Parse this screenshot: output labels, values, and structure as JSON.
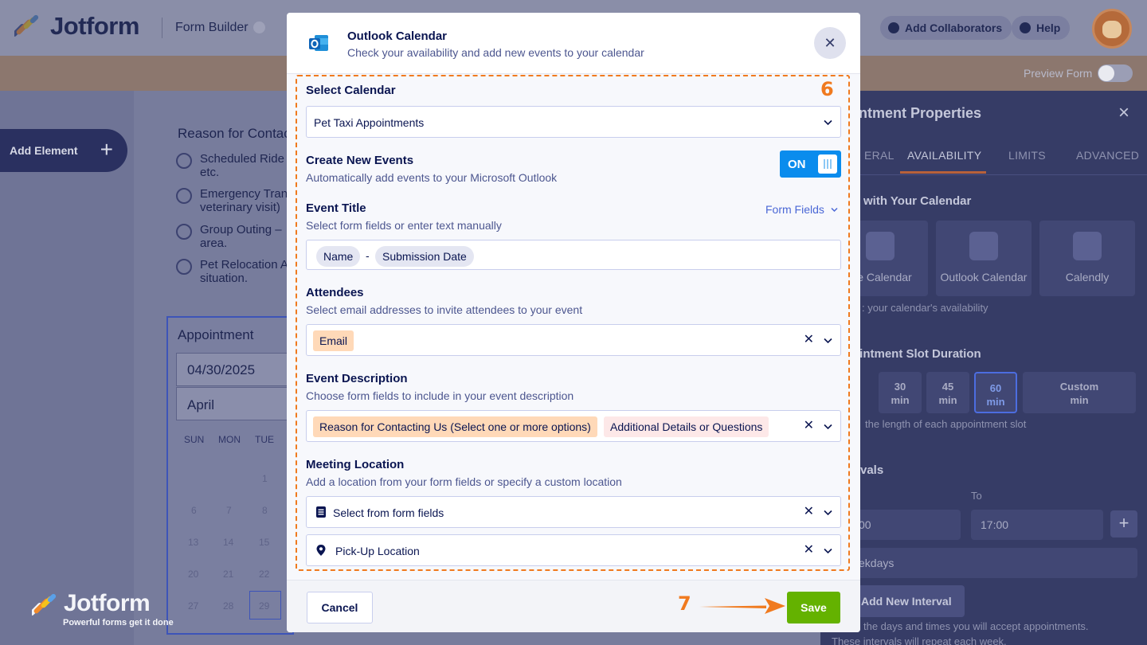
{
  "app": {
    "logo_text": "Jotform",
    "builder_label": "Form Builder",
    "add_collaborators": "Add Collaborators",
    "help": "Help",
    "preview_form": "Preview Form",
    "add_element": "Add Element"
  },
  "form_canvas": {
    "reason_title": "Reason for Contac",
    "options": [
      {
        "line1": "Scheduled Ride",
        "line2": "etc."
      },
      {
        "line1": "Emergency Tran",
        "line2": "veterinary visit)"
      },
      {
        "line1": "Group Outing –",
        "line2": "area."
      },
      {
        "line1": "Pet Relocation A",
        "line2": "situation."
      }
    ],
    "appointment_title": "Appointment",
    "date_value": "04/30/2025",
    "month_value": "April",
    "weekdays": [
      "SUN",
      "MON",
      "TUE"
    ],
    "days": [
      "1",
      "6",
      "7",
      "8",
      "13",
      "14",
      "15",
      "20",
      "21",
      "22",
      "27",
      "28",
      "29"
    ]
  },
  "watermark": {
    "name": "Jotform",
    "tagline": "Powerful forms get it done"
  },
  "properties_panel": {
    "title": "ointment Properties",
    "tabs": [
      "ERAL",
      "AVAILABILITY",
      "LIMITS",
      "ADVANCED"
    ],
    "active_tab": "AVAILABILITY",
    "sync_heading": "with Your Calendar",
    "calendars": [
      "gle Calendar",
      "Outlook Calendar",
      "Calendly"
    ],
    "sync_note": ": your calendar's availability",
    "slot_heading": "pintment Slot Duration",
    "slots": [
      {
        "value": "30",
        "unit": "min"
      },
      {
        "value": "45",
        "unit": "min"
      },
      {
        "value": "60",
        "unit": "min"
      },
      {
        "value": "Custom",
        "unit": "min"
      }
    ],
    "selected_slot": "60",
    "slot_note": "the length of each appointment slot",
    "intervals_heading": "vals",
    "to_label": "To",
    "from_value": "00",
    "to_value": "17:00",
    "days_value": "ekdays",
    "add_interval": "Add New Interval",
    "intervals_note1": "the days and times you will accept appointments.",
    "intervals_note2": "These intervals will repeat each week."
  },
  "modal": {
    "title": "Outlook Calendar",
    "subtitle": "Check your availability and add new events to your calendar",
    "step6": "6",
    "select_calendar": {
      "label": "Select Calendar",
      "value": "Pet Taxi Appointments"
    },
    "create_events": {
      "label": "Create New Events",
      "description": "Automatically add events to your Microsoft Outlook",
      "toggle": "ON"
    },
    "event_title": {
      "label": "Event Title",
      "description": "Select form fields or enter text manually",
      "form_fields_link": "Form Fields",
      "chip1": "Name",
      "separator": "-",
      "chip2": "Submission Date"
    },
    "attendees": {
      "label": "Attendees",
      "description": "Select email addresses to invite attendees to your event",
      "tag": "Email"
    },
    "event_description": {
      "label": "Event Description",
      "description": "Choose form fields to include in your event description",
      "tag1": "Reason for Contacting Us (Select one or more options)",
      "tag2": "Additional Details or Questions"
    },
    "meeting_location": {
      "label": "Meeting Location",
      "description": "Add a location from your form fields or specify a custom location",
      "select_placeholder": "Select from form fields",
      "location_value": "Pick-Up Location"
    },
    "cancel": "Cancel",
    "save": "Save",
    "step7": "7"
  },
  "colors": {
    "accent_orange": "#f07a1f",
    "save_green": "#64b200",
    "toggle_blue": "#0a8ced",
    "navy": "#0a1551"
  }
}
